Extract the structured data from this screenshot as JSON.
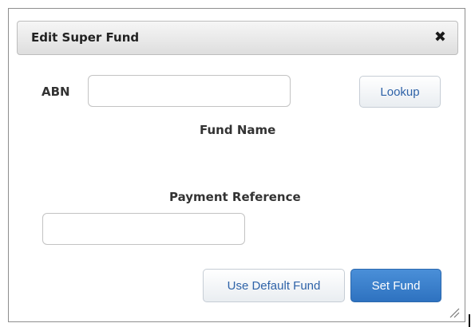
{
  "dialog": {
    "title": "Edit Super Fund",
    "close_glyph": "✖",
    "close_icon": "close-icon"
  },
  "abn": {
    "label": "ABN",
    "value": "",
    "placeholder": ""
  },
  "lookup_button": {
    "label": "Lookup"
  },
  "fund_name": {
    "label": "Fund Name"
  },
  "payment_reference": {
    "label": "Payment Reference",
    "value": "",
    "placeholder": ""
  },
  "actions": {
    "use_default_label": "Use Default Fund",
    "set_fund_label": "Set Fund"
  },
  "colors": {
    "primary_button": "#3a7fcb",
    "secondary_button_text": "#2f63a8",
    "title_bar": "#e6e6e6"
  },
  "icons": {
    "resize": "resize-grip-icon"
  }
}
